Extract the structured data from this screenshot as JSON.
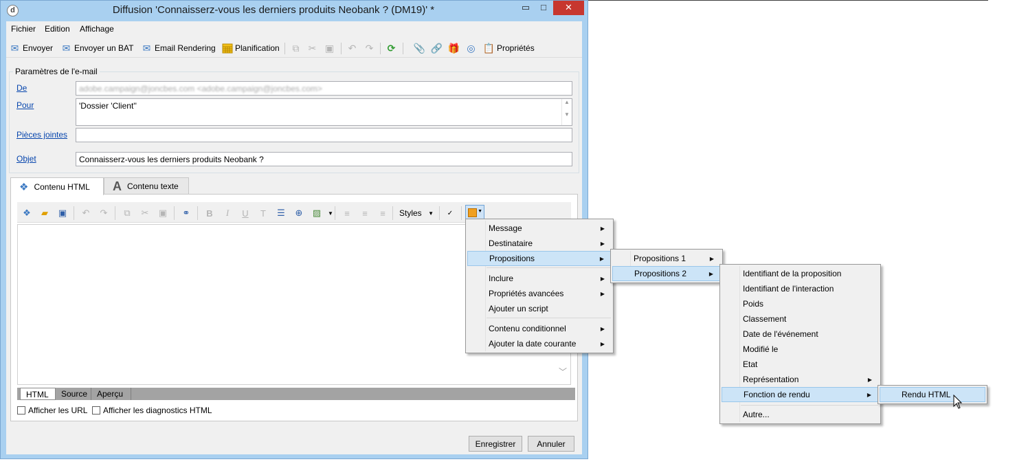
{
  "window": {
    "title": "Diffusion 'Connaisserz-vous les derniers produits Neobank ? (DM19)' *",
    "app_icon": "d",
    "minimize": "▭",
    "maximize": "□",
    "close": "✕"
  },
  "menubar": {
    "items": [
      "Fichier",
      "Edition",
      "Affichage"
    ]
  },
  "toolbar": {
    "send": "Envoyer",
    "send_proof": "Envoyer un BAT",
    "email_rendering": "Email Rendering",
    "planning": "Planification",
    "properties": "Propriétés"
  },
  "params": {
    "group_title": "Paramètres de l'e-mail",
    "from_label": "De",
    "from_value": "adobe.campaign@joncbes.com <adobe.campaign@joncbes.com>",
    "to_label": "Pour",
    "to_value": "'Dossier 'Client''",
    "attachments_label": "Pièces jointes",
    "attachments_value": "",
    "subject_label": "Objet",
    "subject_value": "Connaisserz-vous les derniers produits Neobank ?"
  },
  "tabs": {
    "html": "Contenu HTML",
    "text": "Contenu texte"
  },
  "editor": {
    "styles": "Styles",
    "view_tabs": [
      "HTML",
      "Source",
      "Aperçu"
    ],
    "show_urls": "Afficher les URL",
    "show_diagnostics": "Afficher les diagnostics HTML"
  },
  "buttons": {
    "save": "Enregistrer",
    "cancel": "Annuler"
  },
  "menu1": {
    "items": [
      "Message",
      "Destinataire",
      "Propositions",
      "Inclure",
      "Propriétés avancées",
      "Ajouter un script",
      "Contenu conditionnel",
      "Ajouter la date courante"
    ]
  },
  "menu2": {
    "items": [
      "Propositions 1",
      "Propositions 2"
    ]
  },
  "menu3": {
    "items": [
      "Identifiant de la proposition",
      "Identifiant de l'interaction",
      "Poids",
      "Classement",
      "Date de l'événement",
      "Modifié le",
      "Etat",
      "Représentation",
      "Fonction de rendu",
      "Autre..."
    ]
  },
  "menu4": {
    "items": [
      "Rendu HTML"
    ]
  },
  "colors": {
    "window_frame": "#a9d0f0",
    "close_button": "#c7372f",
    "menu_highlight": "#cce4f7",
    "link": "#0645ad"
  }
}
